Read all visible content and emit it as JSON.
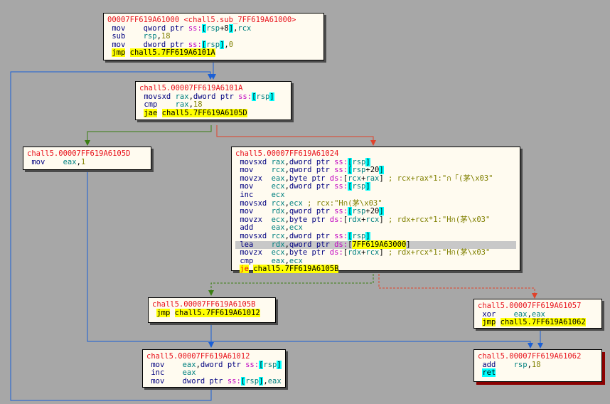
{
  "blocks": {
    "b1000": {
      "header": "00007FF619A61000 <chall5.sub_7FF619A61000>",
      "lines": [
        {
          "mn": "mov",
          "ops": [
            [
              "kw",
              "qword ptr "
            ],
            [
              "sg",
              "ss:"
            ],
            [
              "br",
              "["
            ],
            [
              "rg",
              "rsp"
            ],
            [
              "pl",
              "+8"
            ],
            [
              "br",
              "]"
            ],
            [
              "pl",
              ","
            ],
            [
              "rg",
              "rcx"
            ]
          ]
        },
        {
          "mn": "sub",
          "ops": [
            [
              "rg",
              "rsp"
            ],
            [
              "pl",
              ","
            ],
            [
              "nm",
              "18"
            ]
          ]
        },
        {
          "mn": "mov",
          "ops": [
            [
              "kw",
              "dword ptr "
            ],
            [
              "sg",
              "ss:"
            ],
            [
              "br",
              "["
            ],
            [
              "rg",
              "rsp"
            ],
            [
              "br",
              "]"
            ],
            [
              "pl",
              ","
            ],
            [
              "nm",
              "0"
            ]
          ]
        },
        {
          "mn": "jmp",
          "jmp": true,
          "ops": [
            [
              "jt",
              "chall5.7FF619A6101A"
            ]
          ]
        }
      ]
    },
    "b101a": {
      "header": "chall5.00007FF619A6101A",
      "lines": [
        {
          "mn": "movsxd",
          "ops": [
            [
              "rg",
              "rax"
            ],
            [
              "pl",
              ","
            ],
            [
              "kw",
              "dword ptr "
            ],
            [
              "sg",
              "ss:"
            ],
            [
              "br",
              "["
            ],
            [
              "rg",
              "rsp"
            ],
            [
              "br",
              "]"
            ]
          ]
        },
        {
          "mn": "cmp",
          "ops": [
            [
              "rg",
              "rax"
            ],
            [
              "pl",
              ","
            ],
            [
              "nm",
              "18"
            ]
          ]
        },
        {
          "mn": "jae",
          "jmp": true,
          "ops": [
            [
              "jt",
              "chall5.7FF619A6105D"
            ]
          ]
        }
      ]
    },
    "b105d": {
      "header": "chall5.00007FF619A6105D",
      "lines": [
        {
          "mn": "mov",
          "ops": [
            [
              "rg",
              "eax"
            ],
            [
              "pl",
              ","
            ],
            [
              "nm",
              "1"
            ]
          ]
        }
      ]
    },
    "b1024": {
      "header": "chall5.00007FF619A61024",
      "lines": [
        {
          "mn": "movsxd",
          "ops": [
            [
              "rg",
              "rax"
            ],
            [
              "pl",
              ","
            ],
            [
              "kw",
              "dword ptr "
            ],
            [
              "sg",
              "ss:"
            ],
            [
              "br",
              "["
            ],
            [
              "rg",
              "rsp"
            ],
            [
              "br",
              "]"
            ]
          ]
        },
        {
          "mn": "mov",
          "ops": [
            [
              "rg",
              "rcx"
            ],
            [
              "pl",
              ","
            ],
            [
              "kw",
              "qword ptr "
            ],
            [
              "sg",
              "ss:"
            ],
            [
              "br",
              "["
            ],
            [
              "rg",
              "rsp"
            ],
            [
              "pl",
              "+20"
            ],
            [
              "br",
              "]"
            ]
          ]
        },
        {
          "mn": "movzx",
          "ops": [
            [
              "rg",
              "eax"
            ],
            [
              "pl",
              ","
            ],
            [
              "kw",
              "byte ptr "
            ],
            [
              "sg",
              "ds:"
            ],
            [
              "pl",
              "["
            ],
            [
              "rg",
              "rcx"
            ],
            [
              "pl",
              "+"
            ],
            [
              "rg",
              "rax"
            ],
            [
              "pl",
              "]"
            ],
            [
              "cm",
              " ; rcx+rax*1:\"ก「(茅\\x03\""
            ]
          ]
        },
        {
          "mn": "mov",
          "ops": [
            [
              "rg",
              "ecx"
            ],
            [
              "pl",
              ","
            ],
            [
              "kw",
              "dword ptr "
            ],
            [
              "sg",
              "ss:"
            ],
            [
              "br",
              "["
            ],
            [
              "rg",
              "rsp"
            ],
            [
              "br",
              "]"
            ]
          ]
        },
        {
          "mn": "inc",
          "ops": [
            [
              "rg",
              "ecx"
            ]
          ]
        },
        {
          "mn": "movsxd",
          "ops": [
            [
              "rg",
              "rcx"
            ],
            [
              "pl",
              ","
            ],
            [
              "rg",
              "ecx"
            ],
            [
              "cm",
              " ; rcx:\"Hก(茅\\x03\""
            ]
          ]
        },
        {
          "mn": "mov",
          "ops": [
            [
              "rg",
              "rdx"
            ],
            [
              "pl",
              ","
            ],
            [
              "kw",
              "qword ptr "
            ],
            [
              "sg",
              "ss:"
            ],
            [
              "br",
              "["
            ],
            [
              "rg",
              "rsp"
            ],
            [
              "pl",
              "+20"
            ],
            [
              "br",
              "]"
            ]
          ]
        },
        {
          "mn": "movzx",
          "ops": [
            [
              "rg",
              "ecx"
            ],
            [
              "pl",
              ","
            ],
            [
              "kw",
              "byte ptr "
            ],
            [
              "sg",
              "ds:"
            ],
            [
              "pl",
              "["
            ],
            [
              "rg",
              "rdx"
            ],
            [
              "pl",
              "+"
            ],
            [
              "rg",
              "rcx"
            ],
            [
              "pl",
              "]"
            ],
            [
              "cm",
              " ; rdx+rcx*1:\"Hก(茅\\x03\""
            ]
          ]
        },
        {
          "mn": "add",
          "ops": [
            [
              "rg",
              "eax"
            ],
            [
              "pl",
              ","
            ],
            [
              "rg",
              "ecx"
            ]
          ]
        },
        {
          "mn": "movsxd",
          "ops": [
            [
              "rg",
              "rcx"
            ],
            [
              "pl",
              ","
            ],
            [
              "kw",
              "dword ptr "
            ],
            [
              "sg",
              "ss:"
            ],
            [
              "br",
              "["
            ],
            [
              "rg",
              "rsp"
            ],
            [
              "br",
              "]"
            ]
          ]
        },
        {
          "mn": "lea",
          "hl": true,
          "ops": [
            [
              "rg",
              "rdx"
            ],
            [
              "pl",
              ","
            ],
            [
              "kw",
              "qword ptr "
            ],
            [
              "sg",
              "ds:"
            ],
            [
              "pl",
              "["
            ],
            [
              "jt",
              "7FF619A63000"
            ],
            [
              "pl",
              "]"
            ]
          ]
        },
        {
          "mn": "movzx",
          "ops": [
            [
              "rg",
              "ecx"
            ],
            [
              "pl",
              ","
            ],
            [
              "kw",
              "byte ptr "
            ],
            [
              "sg",
              "ds:"
            ],
            [
              "pl",
              "["
            ],
            [
              "rg",
              "rdx"
            ],
            [
              "pl",
              "+"
            ],
            [
              "rg",
              "rcx"
            ],
            [
              "pl",
              "]"
            ],
            [
              "cm",
              " ; rdx+rcx*1:\"Hก(茅\\x03\""
            ]
          ]
        },
        {
          "mn": "cmp",
          "ops": [
            [
              "rg",
              "eax"
            ],
            [
              "pl",
              ","
            ],
            [
              "rg",
              "ecx"
            ]
          ]
        },
        {
          "mn": "je",
          "jmp": true,
          "jm": true,
          "ops": [
            [
              "jt",
              "chall5.7FF619A6105B"
            ]
          ]
        }
      ]
    },
    "b105b": {
      "header": "chall5.00007FF619A6105B",
      "lines": [
        {
          "mn": "jmp",
          "jmp": true,
          "ops": [
            [
              "jt",
              "chall5.7FF619A61012"
            ]
          ]
        }
      ]
    },
    "b1057": {
      "header": "chall5.00007FF619A61057",
      "lines": [
        {
          "mn": "xor",
          "ops": [
            [
              "rg",
              "eax"
            ],
            [
              "pl",
              ","
            ],
            [
              "rg",
              "eax"
            ]
          ]
        },
        {
          "mn": "jmp",
          "jmp": true,
          "ops": [
            [
              "jt",
              "chall5.7FF619A61062"
            ]
          ]
        }
      ]
    },
    "b1012": {
      "header": "chall5.00007FF619A61012",
      "lines": [
        {
          "mn": "mov",
          "ops": [
            [
              "rg",
              "eax"
            ],
            [
              "pl",
              ","
            ],
            [
              "kw",
              "dword ptr "
            ],
            [
              "sg",
              "ss:"
            ],
            [
              "br",
              "["
            ],
            [
              "rg",
              "rsp"
            ],
            [
              "br",
              "]"
            ]
          ]
        },
        {
          "mn": "inc",
          "ops": [
            [
              "rg",
              "eax"
            ]
          ]
        },
        {
          "mn": "mov",
          "ops": [
            [
              "kw",
              "dword ptr "
            ],
            [
              "sg",
              "ss:"
            ],
            [
              "br",
              "["
            ],
            [
              "rg",
              "rsp"
            ],
            [
              "br",
              "]"
            ],
            [
              "pl",
              ","
            ],
            [
              "rg",
              "eax"
            ]
          ]
        }
      ]
    },
    "b1062": {
      "header": "chall5.00007FF619A61062",
      "lines": [
        {
          "mn": "add",
          "ops": [
            [
              "rg",
              "rsp"
            ],
            [
              "pl",
              ","
            ],
            [
              "nm",
              "18"
            ]
          ]
        },
        {
          "mn": "ret",
          "ret": true,
          "ops": []
        }
      ]
    }
  },
  "colors": {
    "background": "#a7a7a7",
    "unconditional_edge": "#1a5fd6",
    "true_edge": "#3a7d12",
    "false_edge": "#e0412a",
    "return_shadow": "#8b0000"
  }
}
